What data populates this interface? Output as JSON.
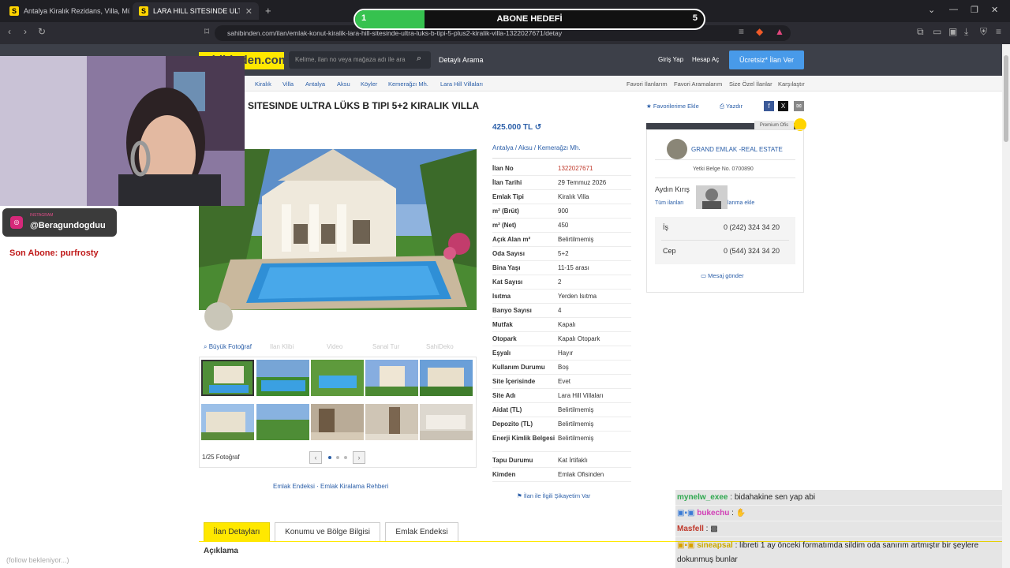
{
  "browser": {
    "tabs": [
      {
        "label": "Antalya Kiralık Rezidans, Villa, Müsta",
        "favicon": "S"
      },
      {
        "label": "LARA HILL SITESINDE ULTRA LÜ",
        "favicon": "S"
      }
    ],
    "url": "sahibinden.com/ilan/emlak-konut-kiralik-lara-hill-sitesinde-ultra-luks-b-tipi-5-plus2-kiralik-villa-1322027671/detay"
  },
  "goal": {
    "label": "ABONE HEDEFİ",
    "current": "1",
    "target": "5",
    "progress": 0.2
  },
  "site": {
    "logo": "sahibinden.com",
    "search_placeholder": "Kelime, ilan no veya mağaza adı ile ara",
    "detailed_search": "Detaylı Arama",
    "login": "Giriş Yap",
    "register": "Hesap Aç",
    "post_ad": "Ücretsiz* İlan Ver"
  },
  "breadcrumb": [
    "Kiralık",
    "Villa",
    "Antalya",
    "Aksu",
    "Köyler",
    "Kemerağzı Mh.",
    "Lara Hill Villaları"
  ],
  "breadcrumb_right": [
    "Favori İlanlarım",
    "Favori Aramalarım",
    "Size Özel İlanlar",
    "Karşılaştır"
  ],
  "listing": {
    "title": "SITESINDE ULTRA LÜKS B TIPI 5+2 KIRALIK VILLA",
    "favorite": "Favorilerime Ekle",
    "print": "Yazdır",
    "price": "425.000 TL",
    "location": "Antalya  /  Aksu  /  Kemerağzı Mh.",
    "photo_tools": [
      "Büyük Fotoğraf",
      "Ilan Klibi",
      "Video",
      "Sanal Tur",
      "SahiDeko"
    ],
    "photo_count": "1/25 Fotoğraf",
    "bottom_links": "Emlak Endeksi    ·    Emlak Kiralama Rehberi",
    "report": "İlan ile İlgili Şikayetim Var",
    "details": [
      {
        "k": "İlan No",
        "v": "1322027671"
      },
      {
        "k": "İlan Tarihi",
        "v": "29 Temmuz 2026"
      },
      {
        "k": "Emlak Tipi",
        "v": "Kiralık Villa"
      },
      {
        "k": "m² (Brüt)",
        "v": "900"
      },
      {
        "k": "m² (Net)",
        "v": "450"
      },
      {
        "k": "Açık Alan m²",
        "v": "Belirtilmemiş"
      },
      {
        "k": "Oda Sayısı",
        "v": "5+2"
      },
      {
        "k": "Bina Yaşı",
        "v": "11-15 arası"
      },
      {
        "k": "Kat Sayısı",
        "v": "2"
      },
      {
        "k": "Isıtma",
        "v": "Yerden Isıtma"
      },
      {
        "k": "Banyo Sayısı",
        "v": "4"
      },
      {
        "k": "Mutfak",
        "v": "Kapalı"
      },
      {
        "k": "Otopark",
        "v": "Kapalı Otopark"
      },
      {
        "k": "Eşyalı",
        "v": "Hayır"
      },
      {
        "k": "Kullanım Durumu",
        "v": "Boş"
      },
      {
        "k": "Site İçerisinde",
        "v": "Evet"
      },
      {
        "k": "Site Adı",
        "v": "Lara Hill Villaları"
      },
      {
        "k": "Aidat (TL)",
        "v": "Belirtilmemiş"
      },
      {
        "k": "Depozito (TL)",
        "v": "Belirtilmemiş"
      },
      {
        "k": "Enerji Kimlik Belgesi",
        "v": "Belirtilmemiş"
      },
      {
        "k": "Tapu Durumu",
        "v": "Kat İrtifaklı"
      },
      {
        "k": "Kimden",
        "v": "Emlak Ofisinden"
      }
    ]
  },
  "seller": {
    "premium": "Premium Ofis",
    "name": "GRAND EMLAK -REAL ESTATE",
    "auth_no": "Yetki Belge No.  0700890",
    "agent": "Aydın Kırış",
    "all_ads": "Tüm ilanları",
    "fav_seller": "larıma ekle",
    "phones": [
      {
        "label": "İş",
        "number": "0 (242) 324 34 20"
      },
      {
        "label": "Cep",
        "number": "0 (544) 324 34 20"
      }
    ],
    "message": "Mesaj gönder"
  },
  "detail_tabs": [
    "İlan Detayları",
    "Konumu ve Bölge Bilgisi",
    "Emlak Endeksi"
  ],
  "description_heading": "Açıklama",
  "stream": {
    "instagram_label": "INSTAGRAM",
    "instagram_handle": "@Beragundogduu",
    "last_sub": "Son Abone: purfrosty",
    "follow_wait": "(follow bekleniyor...)"
  },
  "chat": [
    {
      "user": "mynelw_exee",
      "color": "#2fa84f",
      "text": "bidahakine sen yap abi"
    },
    {
      "user": "bukechu",
      "color": "#d13fb6",
      "text": ""
    },
    {
      "user": "Masfell",
      "color": "#c0392b",
      "text": ""
    },
    {
      "user": "sineapsal",
      "color": "#c9a800",
      "text": "libreti 1 ay önceki formatımda sildim oda sanırım artmıştır bir şeylere dokunmuş bunlar"
    }
  ],
  "colors": {
    "brand_yellow": "#ffe800",
    "link_blue": "#2a5ea8",
    "header_dark": "#3d4049"
  }
}
